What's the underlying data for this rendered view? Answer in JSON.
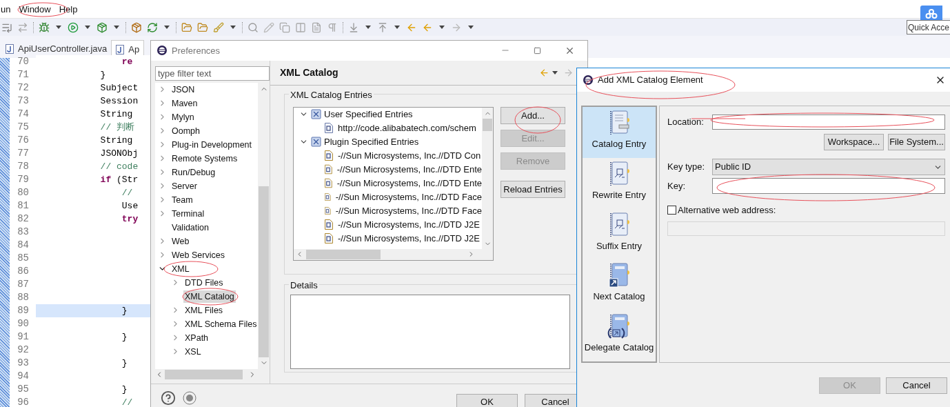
{
  "menu_bar": [
    "un",
    "Window",
    "Help"
  ],
  "quick_access": {
    "placeholder": "Quick Acce"
  },
  "editor": {
    "tabs": [
      {
        "label": "ApiUserController.java",
        "selected": false
      },
      {
        "label": "Ap",
        "selected": true
      }
    ],
    "lines": [
      {
        "number": "70",
        "current": false,
        "tokens": [
          {
            "text": "                re",
            "kind": "keyword"
          }
        ]
      },
      {
        "number": "71",
        "current": false,
        "tokens": [
          {
            "text": "            }",
            "kind": "plain"
          }
        ]
      },
      {
        "number": "72",
        "current": false,
        "tokens": [
          {
            "text": "            Subject",
            "kind": "plain"
          }
        ]
      },
      {
        "number": "73",
        "current": false,
        "tokens": [
          {
            "text": "            Session",
            "kind": "plain"
          }
        ]
      },
      {
        "number": "74",
        "current": false,
        "tokens": [
          {
            "text": "            String",
            "kind": "plain"
          }
        ]
      },
      {
        "number": "75",
        "current": false,
        "tokens": [
          {
            "text": "            // 判断",
            "kind": "comment"
          }
        ]
      },
      {
        "number": "76",
        "current": false,
        "tokens": [
          {
            "text": "            String",
            "kind": "plain"
          }
        ]
      },
      {
        "number": "77",
        "current": false,
        "tokens": [
          {
            "text": "            JSONObj",
            "kind": "plain"
          }
        ]
      },
      {
        "number": "78",
        "current": false,
        "tokens": [
          {
            "text": "            // code",
            "kind": "comment"
          }
        ]
      },
      {
        "number": "79",
        "current": false,
        "tokens": [
          {
            "text": "            if",
            "kind": "keyword"
          },
          {
            "text": " (Str",
            "kind": "plain"
          }
        ]
      },
      {
        "number": "80",
        "current": false,
        "tokens": [
          {
            "text": "                //",
            "kind": "comment"
          }
        ]
      },
      {
        "number": "81",
        "current": false,
        "tokens": [
          {
            "text": "                Use",
            "kind": "plain"
          }
        ]
      },
      {
        "number": "82",
        "current": false,
        "tokens": [
          {
            "text": "                try",
            "kind": "keyword"
          }
        ]
      },
      {
        "number": "83",
        "current": false
      },
      {
        "number": "84",
        "current": false
      },
      {
        "number": "85",
        "current": false
      },
      {
        "number": "86",
        "current": false
      },
      {
        "number": "87",
        "current": false
      },
      {
        "number": "88",
        "current": false
      },
      {
        "number": "89",
        "current": true,
        "tokens": [
          {
            "text": "                }",
            "kind": "plain"
          }
        ]
      },
      {
        "number": "90",
        "current": false
      },
      {
        "number": "91",
        "current": false,
        "tokens": [
          {
            "text": "                }",
            "kind": "plain"
          }
        ]
      },
      {
        "number": "92",
        "current": false
      },
      {
        "number": "93",
        "current": false,
        "tokens": [
          {
            "text": "                }",
            "kind": "plain"
          }
        ]
      },
      {
        "number": "94",
        "current": false
      },
      {
        "number": "95",
        "current": false,
        "tokens": [
          {
            "text": "                }",
            "kind": "plain"
          }
        ]
      },
      {
        "number": "96",
        "current": false,
        "tokens": [
          {
            "text": "                //",
            "kind": "comment"
          }
        ]
      }
    ]
  },
  "preferences": {
    "title": "Preferences",
    "filter": {
      "placeholder": "type filter text"
    },
    "tree": [
      {
        "label": "JSON",
        "kind": "folder",
        "expanded": false,
        "selected": false
      },
      {
        "label": "Maven",
        "kind": "folder",
        "expanded": false,
        "selected": false
      },
      {
        "label": "Mylyn",
        "kind": "folder",
        "expanded": false,
        "selected": false
      },
      {
        "label": "Oomph",
        "kind": "folder",
        "expanded": false,
        "selected": false
      },
      {
        "label": "Plug-in Development",
        "kind": "folder",
        "expanded": false,
        "selected": false
      },
      {
        "label": "Remote Systems",
        "kind": "folder",
        "expanded": false,
        "selected": false
      },
      {
        "label": "Run/Debug",
        "kind": "folder",
        "expanded": false,
        "selected": false
      },
      {
        "label": "Server",
        "kind": "folder",
        "expanded": false,
        "selected": false
      },
      {
        "label": "Team",
        "kind": "folder",
        "expanded": false,
        "selected": false
      },
      {
        "label": "Terminal",
        "kind": "folder",
        "expanded": false,
        "selected": false
      },
      {
        "label": "Validation",
        "kind": "leaf",
        "selected": false
      },
      {
        "label": "Web",
        "kind": "folder",
        "expanded": false,
        "selected": false
      },
      {
        "label": "Web Services",
        "kind": "folder",
        "expanded": false,
        "selected": false
      },
      {
        "label": "XML",
        "kind": "folder",
        "expanded": true,
        "selected": false,
        "children": [
          {
            "label": "DTD Files",
            "kind": "folder",
            "expanded": false,
            "selected": false
          },
          {
            "label": "XML Catalog",
            "kind": "leaf",
            "selected": true
          },
          {
            "label": "XML Files",
            "kind": "folder",
            "expanded": false,
            "selected": false
          },
          {
            "label": "XML Schema Files",
            "kind": "folder",
            "expanded": false,
            "selected": false
          },
          {
            "label": "XPath",
            "kind": "folder",
            "expanded": false,
            "selected": false
          },
          {
            "label": "XSL",
            "kind": "folder",
            "expanded": false,
            "selected": false
          }
        ]
      }
    ],
    "page_title": "XML Catalog",
    "entries_group": "XML Catalog Entries",
    "catalog_tree": [
      {
        "label": "User Specified Entries",
        "expanded": true,
        "children": [
          {
            "label": "http://code.alibabatech.com/schem",
            "kind": "schema"
          }
        ]
      },
      {
        "label": "Plugin Specified Entries",
        "expanded": true,
        "children": [
          {
            "label": "-//Sun Microsystems, Inc.//DTD Con",
            "kind": "dtd"
          },
          {
            "label": "-//Sun Microsystems, Inc.//DTD Ente",
            "kind": "dtd"
          },
          {
            "label": "-//Sun Microsystems, Inc.//DTD Ente",
            "kind": "dtd"
          },
          {
            "label": "-//Sun Microsystems, Inc.//DTD Face",
            "kind": "dtd"
          },
          {
            "label": "-//Sun Microsystems, Inc.//DTD Face",
            "kind": "dtd"
          },
          {
            "label": "-//Sun Microsystems, Inc.//DTD J2E",
            "kind": "dtd"
          },
          {
            "label": "-//Sun Microsystems, Inc.//DTD J2E",
            "kind": "dtd"
          }
        ]
      }
    ],
    "entry_buttons": [
      {
        "label": "Add...",
        "disabled": false
      },
      {
        "label": "Edit...",
        "disabled": true
      },
      {
        "label": "Remove",
        "disabled": true
      },
      {
        "label": "Reload Entries",
        "disabled": false
      }
    ],
    "details_group": "Details",
    "footer_buttons": [
      "OK",
      "Cancel"
    ]
  },
  "dialog": {
    "title": "Add XML Catalog Element",
    "categories": [
      {
        "label": "Catalog Entry",
        "kind": "catalog",
        "selected": true
      },
      {
        "label": "Rewrite Entry",
        "kind": "rewrite",
        "selected": false
      },
      {
        "label": "Suffix Entry",
        "kind": "suffix",
        "selected": false
      },
      {
        "label": "Next Catalog",
        "kind": "next",
        "selected": false
      },
      {
        "label": "Delegate Catalog",
        "kind": "delegate",
        "selected": false
      }
    ],
    "location_label": "Location:",
    "browse_buttons": [
      "Workspace...",
      "File System..."
    ],
    "key_type_label": "Key type:",
    "key_type_value": "Public ID",
    "key_label": "Key:",
    "alternative": {
      "label": "Alternative web address:",
      "checked": false
    },
    "footer_buttons": [
      {
        "label": "OK",
        "disabled": true
      },
      {
        "label": "Cancel",
        "disabled": false
      }
    ]
  }
}
